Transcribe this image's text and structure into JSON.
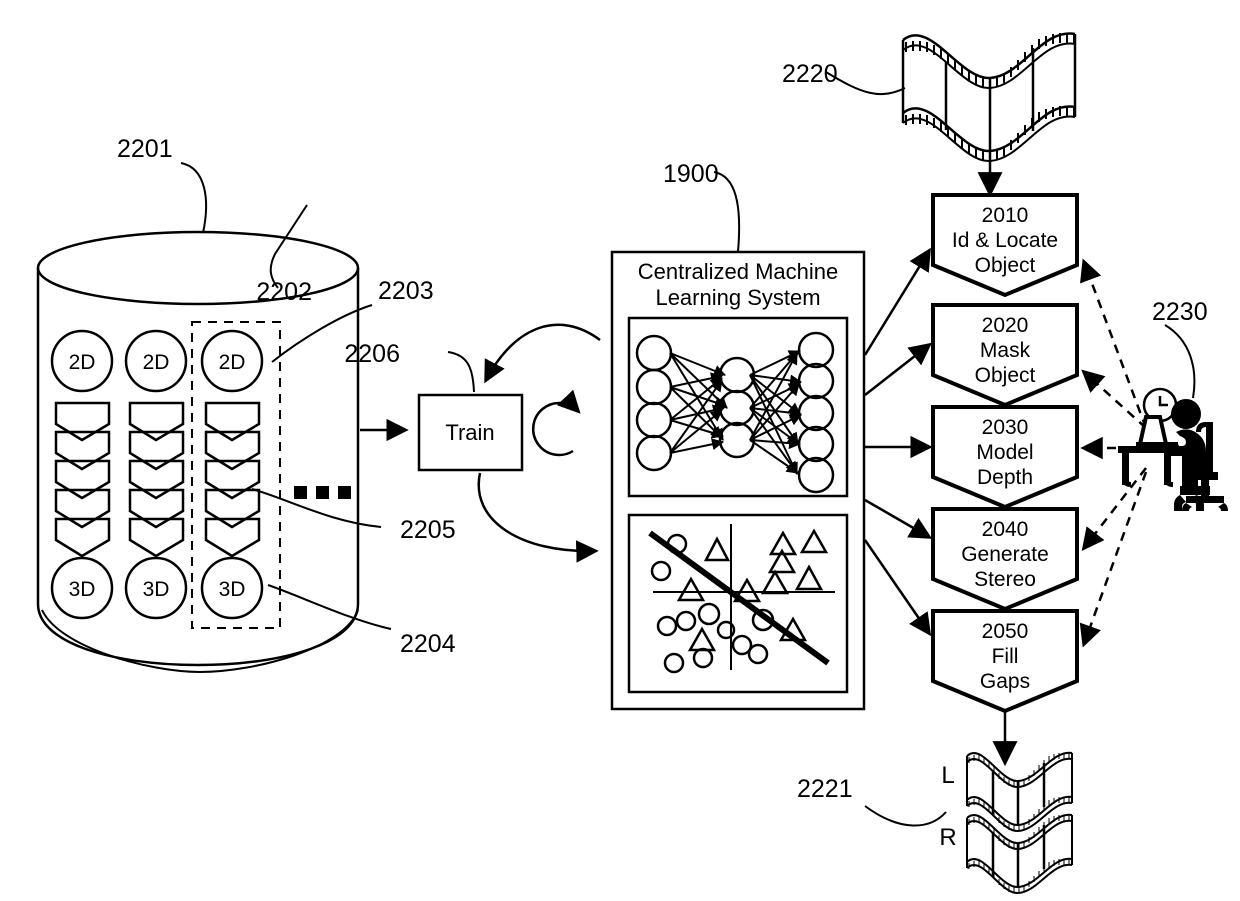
{
  "figure": {
    "title": "Machine learning 2D to 3D conversion pipeline",
    "domain": "patent-diagram"
  },
  "database": {
    "ref_cylinder": "2201",
    "ref_dashed_group": "2202",
    "ref_2d_item": "2203",
    "ref_cylinder_body": "2204",
    "ref_chevron_stack": "2205",
    "columns": [
      {
        "top_label": "2D",
        "bottom_label": "3D",
        "chevrons": 5
      },
      {
        "top_label": "2D",
        "bottom_label": "3D",
        "chevrons": 5
      },
      {
        "top_label": "2D",
        "bottom_label": "3D",
        "chevrons": 5
      }
    ],
    "ellipsis": "■ ■ ■"
  },
  "train": {
    "label": "Train",
    "ref": "2206"
  },
  "ml_system": {
    "ref": "1900",
    "title_line1": "Centralized Machine",
    "title_line2": "Learning System",
    "neural_net": {
      "input_nodes": 4,
      "hidden_nodes": 3,
      "output_nodes": 5
    },
    "scatter": {
      "circles": 16,
      "triangles": 13,
      "has_decision_boundary": true,
      "has_axes": true
    }
  },
  "input_media": {
    "ref": "2220",
    "type": "film-strip"
  },
  "output_media": {
    "ref": "2221",
    "left_label": "L",
    "right_label": "R"
  },
  "operator": {
    "ref": "2230",
    "icons": [
      "clock-icon",
      "person-at-desk-icon"
    ]
  },
  "process_steps": [
    {
      "number": "2010",
      "line1": "Id & Locate",
      "line2": "Object"
    },
    {
      "number": "2020",
      "line1": "Mask",
      "line2": "Object"
    },
    {
      "number": "2030",
      "line1": "Model",
      "line2": "Depth"
    },
    {
      "number": "2040",
      "line1": "Generate",
      "line2": "Stereo"
    },
    {
      "number": "2050",
      "line1": "Fill",
      "line2": "Gaps"
    }
  ],
  "colors": {
    "stroke": "#000000",
    "background": "#ffffff"
  }
}
